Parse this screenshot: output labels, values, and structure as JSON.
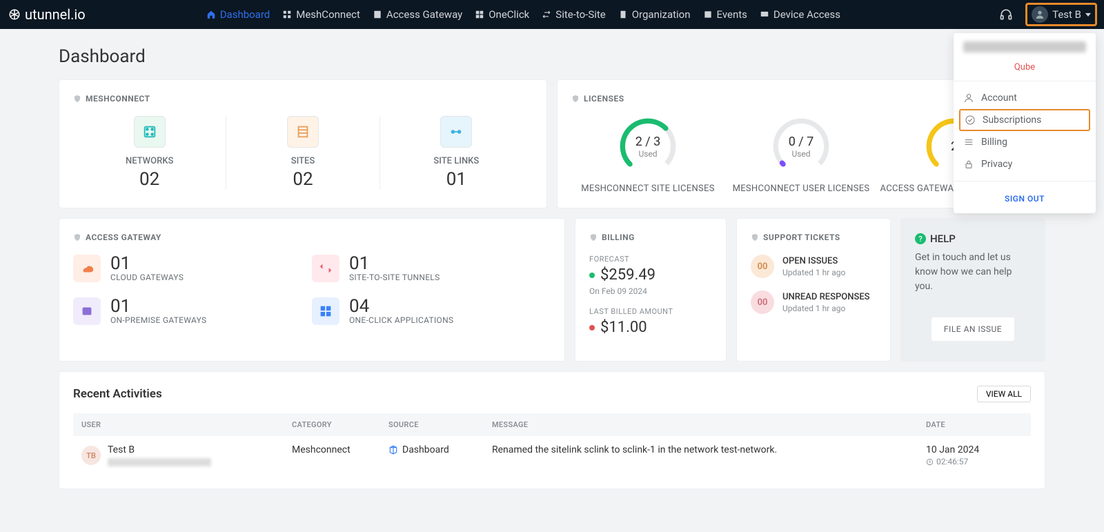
{
  "brand": "utunnel.io",
  "nav": {
    "dashboard": "Dashboard",
    "meshconnect": "MeshConnect",
    "accessgw": "Access Gateway",
    "oneclick": "OneClick",
    "s2s": "Site-to-Site",
    "org": "Organization",
    "events": "Events",
    "devaccess": "Device Access"
  },
  "user": {
    "name": "Test B"
  },
  "page_title": "Dashboard",
  "meshconnect": {
    "title": "MESHCONNECT",
    "networks_label": "NETWORKS",
    "networks_value": "02",
    "sites_label": "SITES",
    "sites_value": "02",
    "sitelinks_label": "SITE LINKS",
    "sitelinks_value": "01"
  },
  "licenses": {
    "title": "LICENSES",
    "used_label": "Used",
    "site": {
      "ratio": "2 / 3",
      "label": "MESHCONNECT SITE LICENSES"
    },
    "user": {
      "ratio": "0 / 7",
      "label": "MESHCONNECT USER LICENSES"
    },
    "agw": {
      "ratio": "2",
      "label": "ACCESS GATEWAY USER LICENSES"
    }
  },
  "accessgw": {
    "title": "ACCESS GATEWAY",
    "cloud": {
      "value": "01",
      "label": "CLOUD GATEWAYS"
    },
    "onprem": {
      "value": "01",
      "label": "ON-PREMISE GATEWAYS"
    },
    "s2s": {
      "value": "01",
      "label": "SITE-TO-SITE TUNNELS"
    },
    "apps": {
      "value": "04",
      "label": "ONE-CLICK APPLICATIONS"
    }
  },
  "billing": {
    "title": "BILLING",
    "forecast_label": "FORECAST",
    "forecast_value": "$259.49",
    "forecast_date": "On Feb 09 2024",
    "last_label": "LAST BILLED AMOUNT",
    "last_value": "$11.00"
  },
  "tickets": {
    "title": "SUPPORT TICKETS",
    "open": {
      "count": "00",
      "label": "OPEN ISSUES",
      "sub": "Updated 1 hr ago"
    },
    "unread": {
      "count": "00",
      "label": "UNREAD RESPONSES",
      "sub": "Updated 1 hr ago"
    }
  },
  "help": {
    "title": "HELP",
    "text": "Get in touch and let us know how we can help you.",
    "button": "FILE AN ISSUE"
  },
  "recent": {
    "title": "Recent Activities",
    "view_all": "VIEW ALL",
    "headers": {
      "user": "USER",
      "category": "CATEGORY",
      "source": "SOURCE",
      "message": "MESSAGE",
      "date": "DATE"
    },
    "row": {
      "initials": "TB",
      "user": "Test B",
      "category": "Meshconnect",
      "source": "Dashboard",
      "message": "Renamed the sitelink sclink to sclink-1 in the network test-network.",
      "date": "10 Jan 2024",
      "time": "02:46:57"
    }
  },
  "dropdown": {
    "badge": "Qube",
    "account": "Account",
    "subscriptions": "Subscriptions",
    "billing": "Billing",
    "privacy": "Privacy",
    "signout": "SIGN OUT"
  }
}
